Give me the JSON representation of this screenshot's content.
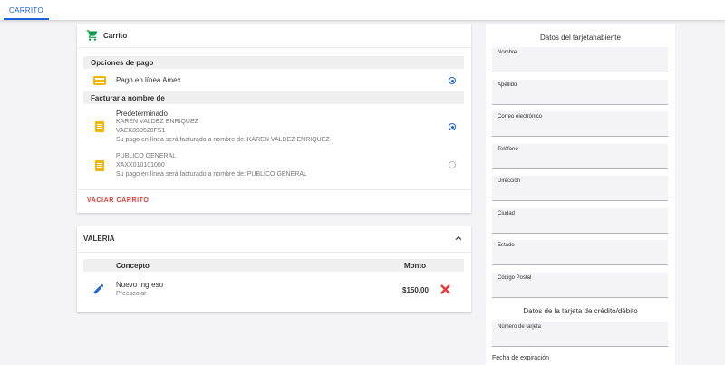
{
  "tabs": [
    {
      "label": "CARRITO"
    }
  ],
  "cart": {
    "title": "Carrito",
    "payment_section": "Opciones de pago",
    "payment_option": "Pago en línea Amex",
    "billing_section": "Facturar a nombre de",
    "billing_options": [
      {
        "title": "Predeterminado",
        "name": "KAREN VALDEZ ENRIQUEZ",
        "rfc": "VAEK890520FS1",
        "note": "Su pago en línea será facturado a nombre de: KAREN VALDEZ ENRIQUEZ",
        "selected": true
      },
      {
        "name": "PUBLICO GENERAL",
        "rfc": "XAXX010101000",
        "note": "Su pago en línea será facturado a nombre de: PUBLICO GENERAL",
        "selected": false
      }
    ],
    "clear_button": "VACIAR CARRITO"
  },
  "group": {
    "title": "VALERIA",
    "columns": {
      "concept": "Concepto",
      "amount": "Monto"
    },
    "items": [
      {
        "concept": "Nuevo Ingreso",
        "sub": "Preescolar",
        "amount": "$150.00"
      }
    ]
  },
  "cardholder": {
    "title": "Datos del tarjetahabiente",
    "fields": [
      {
        "label": "Nombre",
        "value": ""
      },
      {
        "label": "Apellido",
        "value": ""
      },
      {
        "label": "Correo electrónico",
        "value": ""
      },
      {
        "label": "Teléfono",
        "value": ""
      },
      {
        "label": "Dirección",
        "value": ""
      },
      {
        "label": "Ciudad",
        "value": ""
      },
      {
        "label": "Estado",
        "value": ""
      },
      {
        "label": "Código Postal",
        "value": ""
      }
    ]
  },
  "card_data": {
    "title": "Datos de la tarjeta de crédito/débito",
    "number_label": "Número de tarjeta",
    "number_value": "",
    "expiration_label": "Fecha de expiración"
  },
  "colors": {
    "accent": "#1e63d6",
    "cart_icon": "#0a9e4c",
    "doc_icon": "#f2b705",
    "danger": "#e53935"
  }
}
